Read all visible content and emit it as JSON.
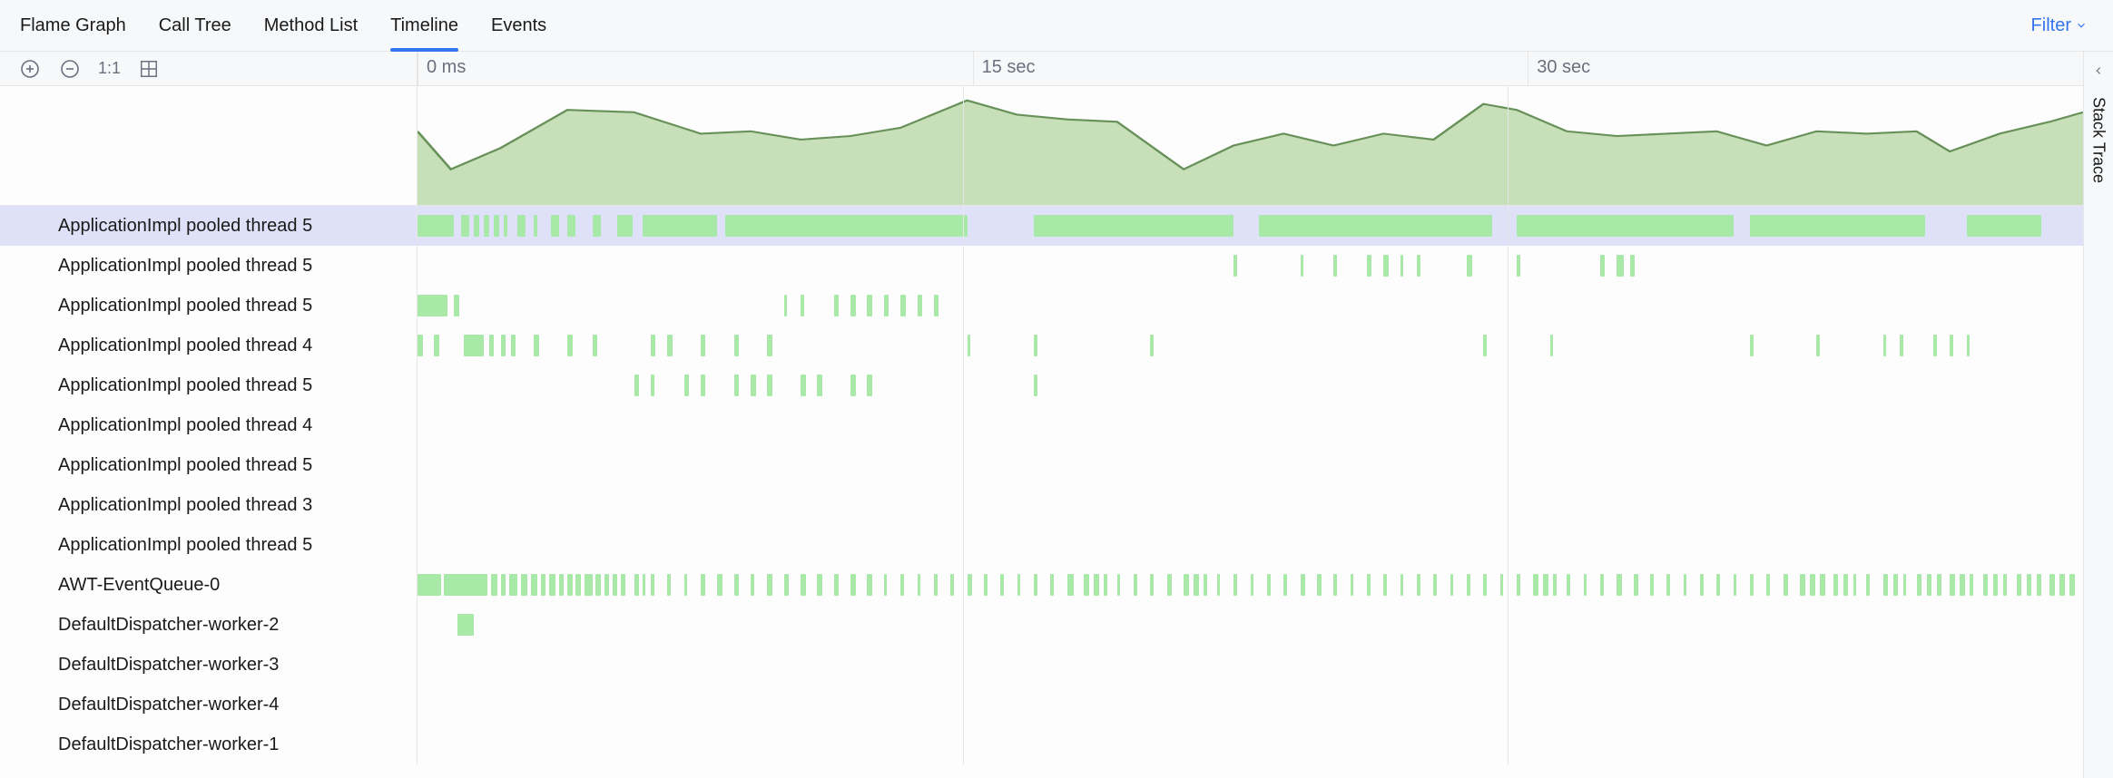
{
  "tabs": {
    "items": [
      "Flame Graph",
      "Call Tree",
      "Method List",
      "Timeline",
      "Events"
    ],
    "active_index": 3,
    "filter_label": "Filter"
  },
  "toolbar": {
    "zoom_in": "zoom-in",
    "zoom_out": "zoom-out",
    "scale_label": "1:1",
    "layout_icon": "layout-grid"
  },
  "ruler": {
    "ticks": [
      {
        "pos_pct": 0.0,
        "label": "0 ms"
      },
      {
        "pos_pct": 33.33,
        "label": "15 sec"
      },
      {
        "pos_pct": 66.66,
        "label": "30 sec"
      }
    ]
  },
  "overview_chart": {
    "fill": "#c7e0b9",
    "stroke": "#68915a",
    "points_pct": [
      [
        0,
        62
      ],
      [
        2,
        30
      ],
      [
        5,
        48
      ],
      [
        9,
        80
      ],
      [
        13,
        78
      ],
      [
        17,
        60
      ],
      [
        20,
        62
      ],
      [
        23,
        55
      ],
      [
        26,
        58
      ],
      [
        29,
        65
      ],
      [
        33,
        88
      ],
      [
        36,
        76
      ],
      [
        39,
        72
      ],
      [
        42,
        70
      ],
      [
        46,
        30
      ],
      [
        49,
        50
      ],
      [
        52,
        60
      ],
      [
        55,
        50
      ],
      [
        58,
        60
      ],
      [
        61,
        55
      ],
      [
        64,
        85
      ],
      [
        66,
        80
      ],
      [
        69,
        62
      ],
      [
        72,
        58
      ],
      [
        75,
        60
      ],
      [
        78,
        62
      ],
      [
        81,
        50
      ],
      [
        84,
        62
      ],
      [
        87,
        60
      ],
      [
        90,
        62
      ],
      [
        92,
        45
      ],
      [
        95,
        60
      ],
      [
        98,
        70
      ],
      [
        100,
        78
      ]
    ]
  },
  "threads": [
    {
      "name": "ApplicationImpl pooled thread 5",
      "selected": true,
      "segments_pct": [
        [
          0,
          2.2
        ],
        [
          2.6,
          0.5
        ],
        [
          3.4,
          0.3
        ],
        [
          4,
          0.3
        ],
        [
          4.6,
          0.3
        ],
        [
          5.2,
          0.2
        ],
        [
          6,
          0.5
        ],
        [
          7,
          0.2
        ],
        [
          8,
          0.5
        ],
        [
          9,
          0.5
        ],
        [
          10.5,
          0.5
        ],
        [
          12,
          0.9
        ],
        [
          13.5,
          4.5
        ],
        [
          18.5,
          14.5
        ],
        [
          37,
          12
        ],
        [
          50.5,
          14
        ],
        [
          66,
          13
        ],
        [
          80,
          10.5
        ],
        [
          93,
          4.5
        ]
      ]
    },
    {
      "name": "ApplicationImpl pooled thread 5",
      "selected": false,
      "segments_pct": [
        [
          49,
          0.2
        ],
        [
          53,
          0.2
        ],
        [
          55,
          0.2
        ],
        [
          57,
          0.3
        ],
        [
          58,
          0.3
        ],
        [
          59,
          0.2
        ],
        [
          60,
          0.2
        ],
        [
          63,
          0.3
        ],
        [
          66,
          0.2
        ],
        [
          71,
          0.3
        ],
        [
          72,
          0.4
        ],
        [
          72.8,
          0.3
        ]
      ]
    },
    {
      "name": "ApplicationImpl pooled thread 5",
      "selected": false,
      "segments_pct": [
        [
          0,
          1.8
        ],
        [
          2.2,
          0.3
        ],
        [
          22,
          0.2
        ],
        [
          23,
          0.2
        ],
        [
          25,
          0.3
        ],
        [
          26,
          0.3
        ],
        [
          27,
          0.3
        ],
        [
          28,
          0.3
        ],
        [
          29,
          0.3
        ],
        [
          30,
          0.3
        ],
        [
          31,
          0.3
        ]
      ]
    },
    {
      "name": "ApplicationImpl pooled thread 4",
      "selected": false,
      "segments_pct": [
        [
          0,
          0.3
        ],
        [
          1,
          0.3
        ],
        [
          2.8,
          1.2
        ],
        [
          4.3,
          0.3
        ],
        [
          5,
          0.3
        ],
        [
          5.6,
          0.3
        ],
        [
          7,
          0.3
        ],
        [
          9,
          0.3
        ],
        [
          10.5,
          0.3
        ],
        [
          14,
          0.3
        ],
        [
          15,
          0.3
        ],
        [
          17,
          0.3
        ],
        [
          19,
          0.3
        ],
        [
          21,
          0.3
        ],
        [
          33,
          0.2
        ],
        [
          37,
          0.2
        ],
        [
          44,
          0.2
        ],
        [
          64,
          0.2
        ],
        [
          68,
          0.2
        ],
        [
          80,
          0.2
        ],
        [
          84,
          0.2
        ],
        [
          88,
          0.2
        ],
        [
          89,
          0.2
        ],
        [
          91,
          0.2
        ],
        [
          92,
          0.2
        ],
        [
          93,
          0.2
        ]
      ]
    },
    {
      "name": "ApplicationImpl pooled thread 5",
      "selected": false,
      "segments_pct": [
        [
          13,
          0.3
        ],
        [
          14,
          0.2
        ],
        [
          16,
          0.3
        ],
        [
          17,
          0.3
        ],
        [
          19,
          0.3
        ],
        [
          20,
          0.3
        ],
        [
          21,
          0.3
        ],
        [
          23,
          0.3
        ],
        [
          24,
          0.3
        ],
        [
          26,
          0.3
        ],
        [
          27,
          0.3
        ],
        [
          37,
          0.2
        ]
      ]
    },
    {
      "name": "ApplicationImpl pooled thread 4",
      "selected": false,
      "segments_pct": []
    },
    {
      "name": "ApplicationImpl pooled thread 5",
      "selected": false,
      "segments_pct": []
    },
    {
      "name": "ApplicationImpl pooled thread 3",
      "selected": false,
      "segments_pct": []
    },
    {
      "name": "ApplicationImpl pooled thread 5",
      "selected": false,
      "segments_pct": []
    },
    {
      "name": "AWT-EventQueue-0",
      "selected": false,
      "segments_pct": [
        [
          0,
          1.4
        ],
        [
          1.6,
          2.6
        ],
        [
          4.4,
          0.4
        ],
        [
          5,
          0.3
        ],
        [
          5.5,
          0.5
        ],
        [
          6.2,
          0.4
        ],
        [
          6.8,
          0.4
        ],
        [
          7.4,
          0.3
        ],
        [
          7.9,
          0.4
        ],
        [
          8.5,
          0.3
        ],
        [
          9,
          0.3
        ],
        [
          9.5,
          0.3
        ],
        [
          10,
          0.5
        ],
        [
          10.7,
          0.3
        ],
        [
          11.2,
          0.3
        ],
        [
          11.7,
          0.3
        ],
        [
          12.2,
          0.3
        ],
        [
          13,
          0.3
        ],
        [
          13.5,
          0.2
        ],
        [
          14,
          0.2
        ],
        [
          15,
          0.2
        ],
        [
          16,
          0.2
        ],
        [
          17,
          0.3
        ],
        [
          18,
          0.3
        ],
        [
          19,
          0.3
        ],
        [
          20,
          0.2
        ],
        [
          21,
          0.3
        ],
        [
          22,
          0.3
        ],
        [
          23,
          0.3
        ],
        [
          24,
          0.3
        ],
        [
          25,
          0.3
        ],
        [
          26,
          0.3
        ],
        [
          27,
          0.3
        ],
        [
          28,
          0.2
        ],
        [
          29,
          0.2
        ],
        [
          30,
          0.2
        ],
        [
          31,
          0.2
        ],
        [
          32,
          0.2
        ],
        [
          33,
          0.3
        ],
        [
          34,
          0.2
        ],
        [
          35,
          0.2
        ],
        [
          36,
          0.2
        ],
        [
          37,
          0.2
        ],
        [
          38,
          0.2
        ],
        [
          39,
          0.4
        ],
        [
          40,
          0.3
        ],
        [
          40.6,
          0.3
        ],
        [
          41.2,
          0.2
        ],
        [
          42,
          0.2
        ],
        [
          43,
          0.2
        ],
        [
          44,
          0.2
        ],
        [
          45,
          0.3
        ],
        [
          46,
          0.3
        ],
        [
          46.6,
          0.3
        ],
        [
          47.2,
          0.2
        ],
        [
          48,
          0.2
        ],
        [
          49,
          0.2
        ],
        [
          50,
          0.2
        ],
        [
          51,
          0.2
        ],
        [
          52,
          0.2
        ],
        [
          53,
          0.3
        ],
        [
          54,
          0.3
        ],
        [
          55,
          0.2
        ],
        [
          56,
          0.2
        ],
        [
          57,
          0.2
        ],
        [
          58,
          0.2
        ],
        [
          59,
          0.2
        ],
        [
          60,
          0.2
        ],
        [
          61,
          0.2
        ],
        [
          62,
          0.2
        ],
        [
          63,
          0.2
        ],
        [
          64,
          0.2
        ],
        [
          65,
          0.2
        ],
        [
          66,
          0.2
        ],
        [
          67,
          0.3
        ],
        [
          67.6,
          0.3
        ],
        [
          68.2,
          0.2
        ],
        [
          69,
          0.2
        ],
        [
          70,
          0.2
        ],
        [
          71,
          0.2
        ],
        [
          72,
          0.3
        ],
        [
          73,
          0.3
        ],
        [
          74,
          0.2
        ],
        [
          75,
          0.2
        ],
        [
          76,
          0.2
        ],
        [
          77,
          0.2
        ],
        [
          78,
          0.2
        ],
        [
          79,
          0.2
        ],
        [
          80,
          0.2
        ],
        [
          81,
          0.2
        ],
        [
          82,
          0.3
        ],
        [
          83,
          0.3
        ],
        [
          83.6,
          0.3
        ],
        [
          84.2,
          0.3
        ],
        [
          85,
          0.3
        ],
        [
          85.6,
          0.3
        ],
        [
          86.2,
          0.2
        ],
        [
          87,
          0.2
        ],
        [
          88,
          0.3
        ],
        [
          88.6,
          0.3
        ],
        [
          89.2,
          0.2
        ],
        [
          90,
          0.3
        ],
        [
          90.6,
          0.3
        ],
        [
          91.2,
          0.3
        ],
        [
          92,
          0.3
        ],
        [
          92.6,
          0.3
        ],
        [
          93.2,
          0.2
        ],
        [
          94,
          0.3
        ],
        [
          94.6,
          0.3
        ],
        [
          95.2,
          0.2
        ],
        [
          96,
          0.3
        ],
        [
          96.6,
          0.3
        ],
        [
          97.2,
          0.3
        ],
        [
          98,
          0.3
        ],
        [
          98.6,
          0.3
        ],
        [
          99.2,
          0.3
        ]
      ]
    },
    {
      "name": "DefaultDispatcher-worker-2",
      "selected": false,
      "segments_pct": [
        [
          2.4,
          1.0
        ]
      ]
    },
    {
      "name": "DefaultDispatcher-worker-3",
      "selected": false,
      "segments_pct": []
    },
    {
      "name": "DefaultDispatcher-worker-4",
      "selected": false,
      "segments_pct": []
    },
    {
      "name": "DefaultDispatcher-worker-1",
      "selected": false,
      "segments_pct": []
    }
  ],
  "side_tab": {
    "label": "Stack Trace"
  },
  "colors": {
    "segment": "#a8e9a8",
    "selected_row": "#dfe1f8",
    "accent": "#3574f0"
  }
}
